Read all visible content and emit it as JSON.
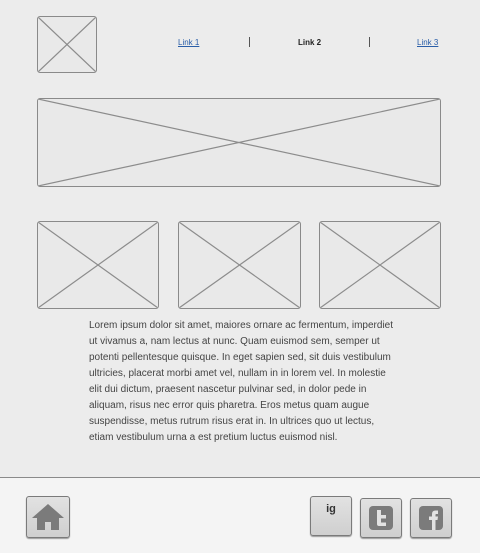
{
  "nav": {
    "links": [
      "Link 1",
      "Link 2",
      "Link 3"
    ],
    "active": "Link 2"
  },
  "content": {
    "text": "Lorem ipsum dolor sit amet, maiores ornare ac fermentum, imperdiet ut vivamus a, nam lectus at nunc. Quam euismod sem, semper ut potenti pellentesque quisque. In eget sapien sed, sit duis vestibulum ultricies, placerat morbi amet vel, nullam in in lorem vel. In molestie elit dui dictum, praesent nascetur pulvinar sed, in dolor pede in aliquam, risus nec error quis pharetra. Eros metus quam augue suspendisse, metus rutrum risus erat in.  In ultrices quo ut lectus, etiam vestibulum urna a est pretium luctus euismod nisl."
  },
  "footer": {
    "social": {
      "instagram_label": "ig",
      "icons": [
        "home-icon",
        "instagram-icon",
        "twitter-icon",
        "facebook-icon"
      ]
    }
  },
  "colors": {
    "background": "#ececec",
    "link": "#2a5ea8",
    "placeholder_border": "#8a8a8a"
  }
}
